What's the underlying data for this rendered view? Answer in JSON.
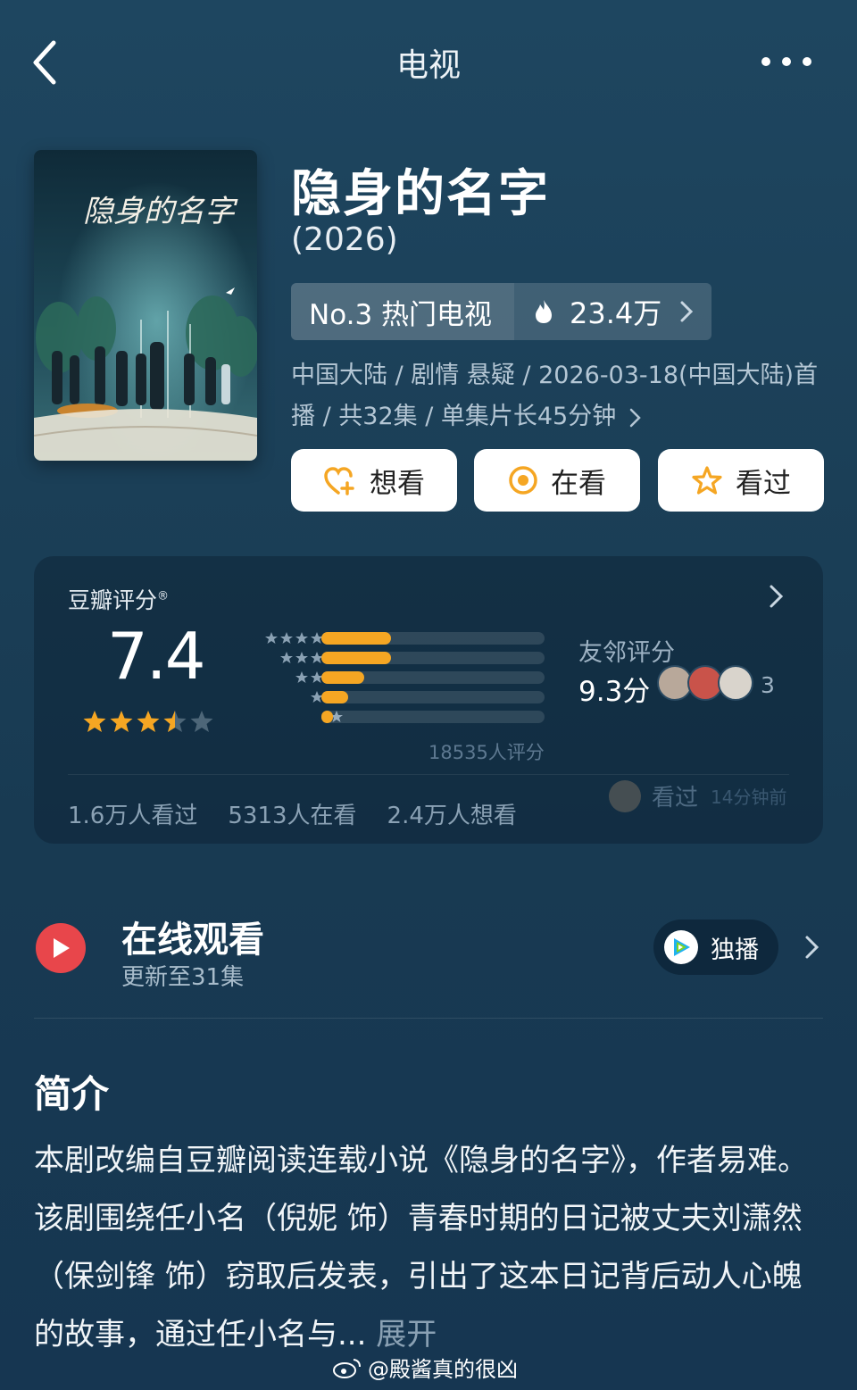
{
  "header": {
    "title": "电视"
  },
  "show": {
    "title": "隐身的名字",
    "year": "(2026)",
    "rank_label": "No.3 热门电视",
    "heat": "23.4万",
    "meta": "中国大陆 / 剧情 悬疑 / 2026-03-18(中国大陆)首播 / 共32集 / 单集片长45分钟"
  },
  "actions": {
    "want": "想看",
    "watching": "在看",
    "watched": "看过"
  },
  "rating": {
    "label": "豆瓣评分",
    "score": "7.4",
    "stars": 3.5,
    "distribution": [
      0.31,
      0.31,
      0.19,
      0.12,
      0.05
    ],
    "count": "18535人评分",
    "friends_label": "友邻评分",
    "friends_score": "9.3分",
    "friends_count": "3",
    "recent_action": "看过",
    "recent_time": "14分钟前",
    "stats": [
      "1.6万人看过",
      "5313人在看",
      "2.4万人想看"
    ]
  },
  "watch": {
    "title": "在线观看",
    "subtitle": "更新至31集",
    "platform_label": "独播"
  },
  "intro": {
    "heading": "简介",
    "text": "本剧改编自豆瓣阅读连载小说《隐身的名字》，作者易难。 该剧围绕任小名（倪妮 饰）青春时期的日记被丈夫刘潇然（保剑锋 饰）窃取后发表，引出了这本日记背后动人心魄的故事，通过任小名与...",
    "more": "展开"
  },
  "watermark": "@殿酱真的很凶",
  "colors": {
    "accent": "#f5a623",
    "play": "#e8464b",
    "bg": "#1b3f57"
  },
  "poster": {
    "title_art": "隐身的名字"
  }
}
